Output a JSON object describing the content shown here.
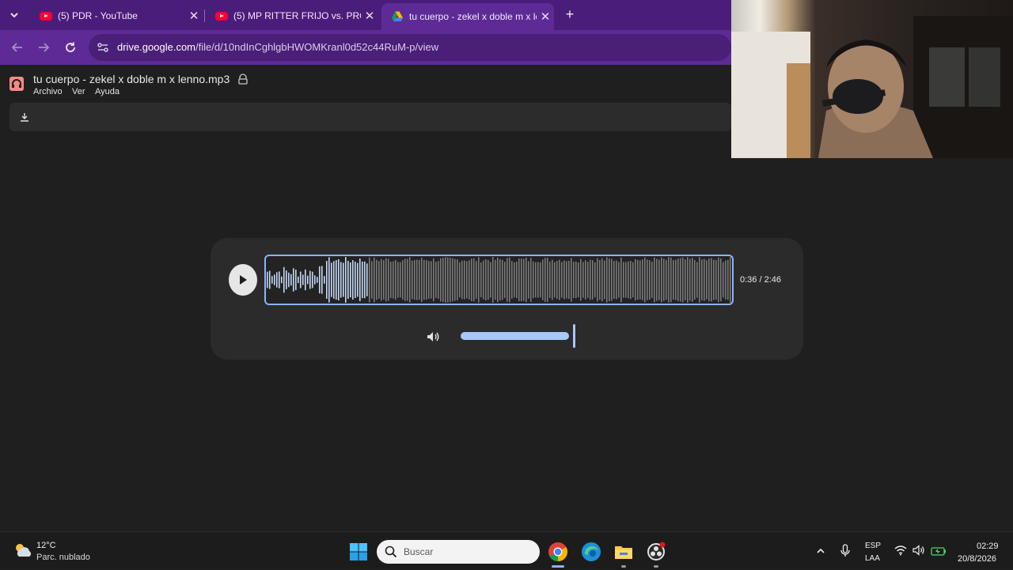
{
  "browser": {
    "tabs": [
      {
        "title": "(5) PDR - YouTube",
        "favicon": "youtube-icon",
        "active": false
      },
      {
        "title": "(5) MP RITTER FRIJO vs. PROME",
        "favicon": "youtube-icon",
        "active": false
      },
      {
        "title": "tu cuerpo - zekel x doble m x le",
        "favicon": "google-drive-icon",
        "active": true
      }
    ],
    "new_tab_label": "+",
    "close_glyph": "✕",
    "address": {
      "host": "drive.google.com",
      "path": "/file/d/10ndInCghlgbHWOMKranl0d52c44RuM-p/view"
    }
  },
  "drive": {
    "file_title": "tu cuerpo - zekel x doble m x lenno.mp3",
    "menu": [
      "Archivo",
      "Ver",
      "Ayuda"
    ]
  },
  "player": {
    "time": "0:36 / 2:46",
    "progress": 0.217,
    "volume": 1.0
  },
  "taskbar": {
    "weather": {
      "temp": "12°C",
      "desc": "Parc. nublado"
    },
    "search_placeholder": "Buscar",
    "lang_top": "ESP",
    "lang_bottom": "LAA",
    "time": "02:29",
    "date": "20/8/2026"
  },
  "colors": {
    "tabstrip": "#4b1d7a",
    "toolbar": "#5e2b96",
    "accent": "#8ab4f8"
  }
}
